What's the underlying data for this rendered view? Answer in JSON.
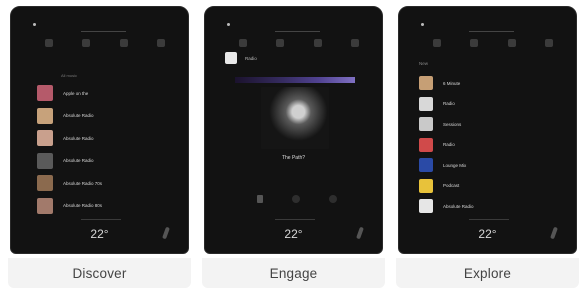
{
  "cards": [
    {
      "caption": "Discover"
    },
    {
      "caption": "Engage"
    },
    {
      "caption": "Explore"
    }
  ],
  "discover": {
    "section_label": "All music",
    "temperature": "22°",
    "items": [
      {
        "label": "Apple on the",
        "thumb_color": "#b55a6a"
      },
      {
        "label": "Absolute Radio",
        "thumb_color": "#c7a27b"
      },
      {
        "label": "Absolute Radio",
        "thumb_color": "#c9a08d"
      },
      {
        "label": "Absolute Radio",
        "thumb_color": "#5a5a5a"
      },
      {
        "label": "Absolute Radio 70s",
        "thumb_color": "#8b6a4e"
      },
      {
        "label": "Absolute Radio 80s",
        "thumb_color": "#a27a6b"
      }
    ]
  },
  "engage": {
    "station": "Radio",
    "song": "The Path?",
    "temperature": "22°"
  },
  "explore": {
    "header": "New",
    "temperature": "22°",
    "items": [
      {
        "label": "6 Minute",
        "thumb_color": "#c69f75"
      },
      {
        "label": "Radio",
        "thumb_color": "#d8d8d8"
      },
      {
        "label": "Sessions",
        "thumb_color": "#c9c9c9"
      },
      {
        "label": "Radio",
        "thumb_color": "#d04a4a"
      },
      {
        "label": "Lounge Mix",
        "thumb_color": "#2a4aa6"
      },
      {
        "label": "Podcast",
        "thumb_color": "#e8c23a"
      },
      {
        "label": "Absolute Radio",
        "thumb_color": "#e6e6e6"
      }
    ]
  }
}
